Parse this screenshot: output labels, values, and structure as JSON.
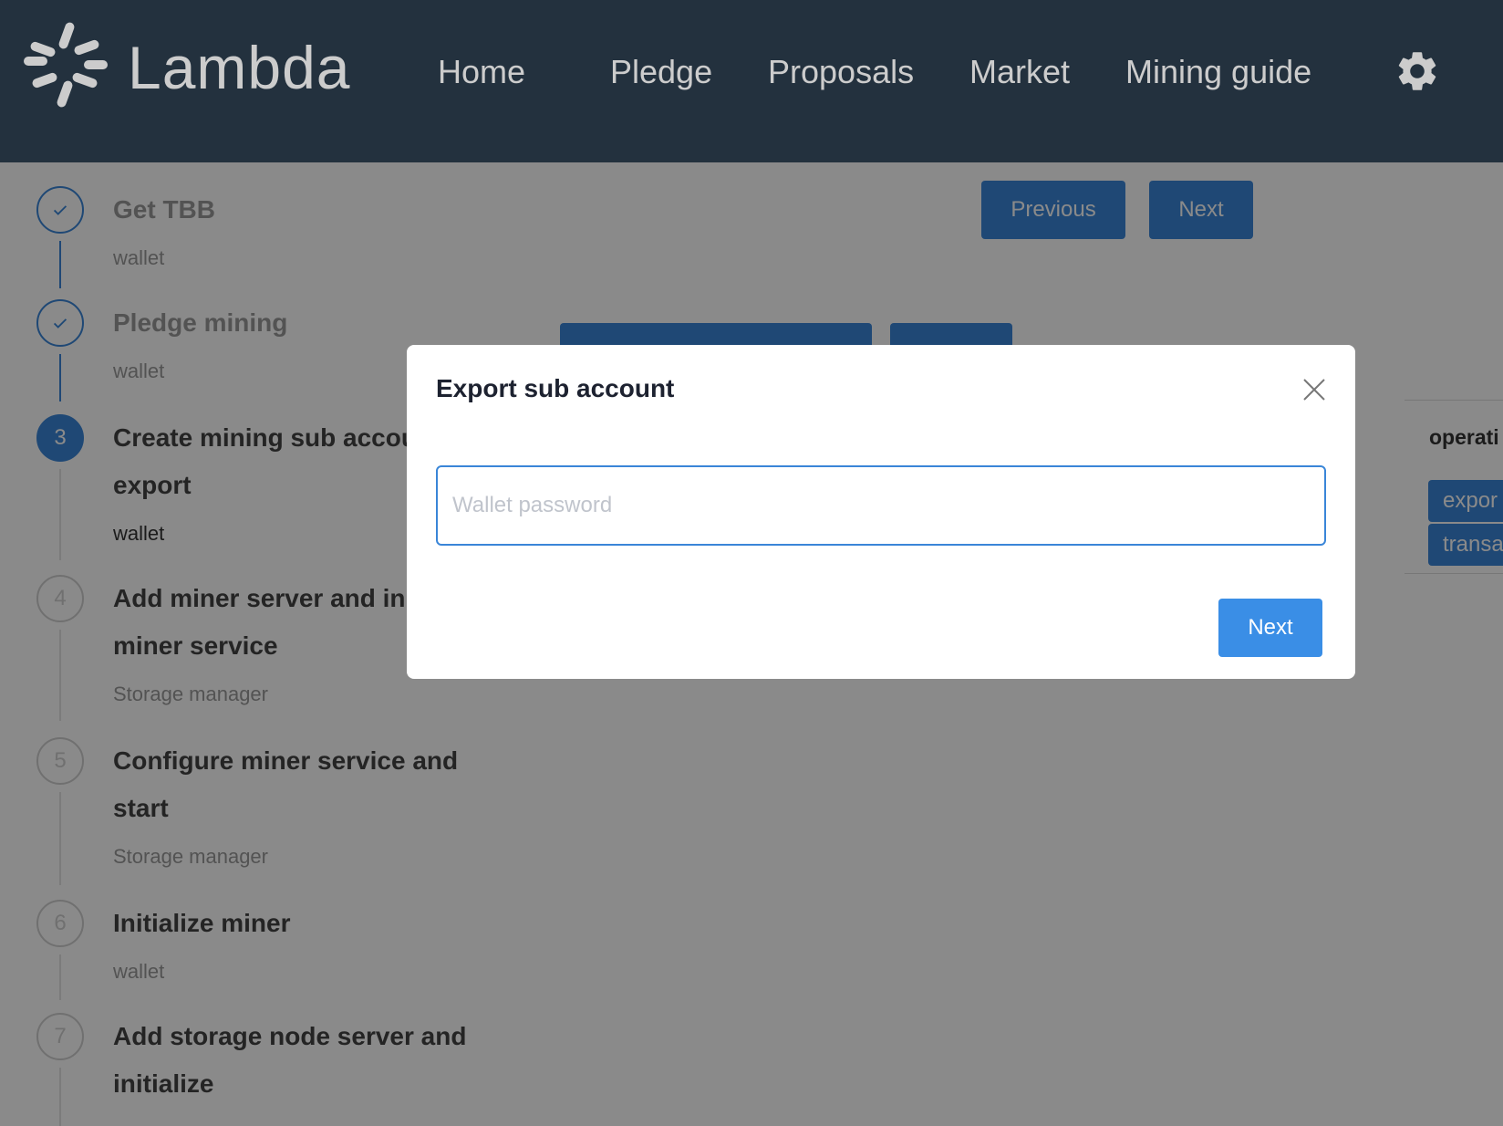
{
  "header": {
    "logo_text": "Lambda",
    "nav": [
      "Home",
      "Pledge",
      "Proposals",
      "Market",
      "Mining guide"
    ],
    "settings_icon": "gear-icon"
  },
  "steps": [
    {
      "title": "Get TBB",
      "desc": "wallet",
      "status": "done",
      "icon": "check-icon"
    },
    {
      "title": "Pledge mining",
      "desc": "wallet",
      "status": "done",
      "icon": "check-icon"
    },
    {
      "number": "3",
      "title": "Create mining sub account and export",
      "desc": "wallet",
      "status": "active"
    },
    {
      "number": "4",
      "title": "Add miner server and initialize miner service",
      "desc": "Storage manager",
      "status": "wait"
    },
    {
      "number": "5",
      "title": "Configure miner service and start",
      "desc": "Storage manager",
      "status": "wait"
    },
    {
      "number": "6",
      "title": "Initialize miner",
      "desc": "wallet",
      "status": "wait"
    },
    {
      "number": "7",
      "title": "Add storage node server and initialize",
      "desc": "",
      "status": "wait"
    }
  ],
  "content": {
    "previous_label": "Previous",
    "next_label": "Next",
    "operation_header": "operati",
    "row_buttons": [
      "expor",
      "transa"
    ]
  },
  "modal": {
    "title": "Export sub account",
    "password_placeholder": "Wallet password",
    "password_value": "",
    "next_label": "Next",
    "close_icon": "close-icon"
  }
}
